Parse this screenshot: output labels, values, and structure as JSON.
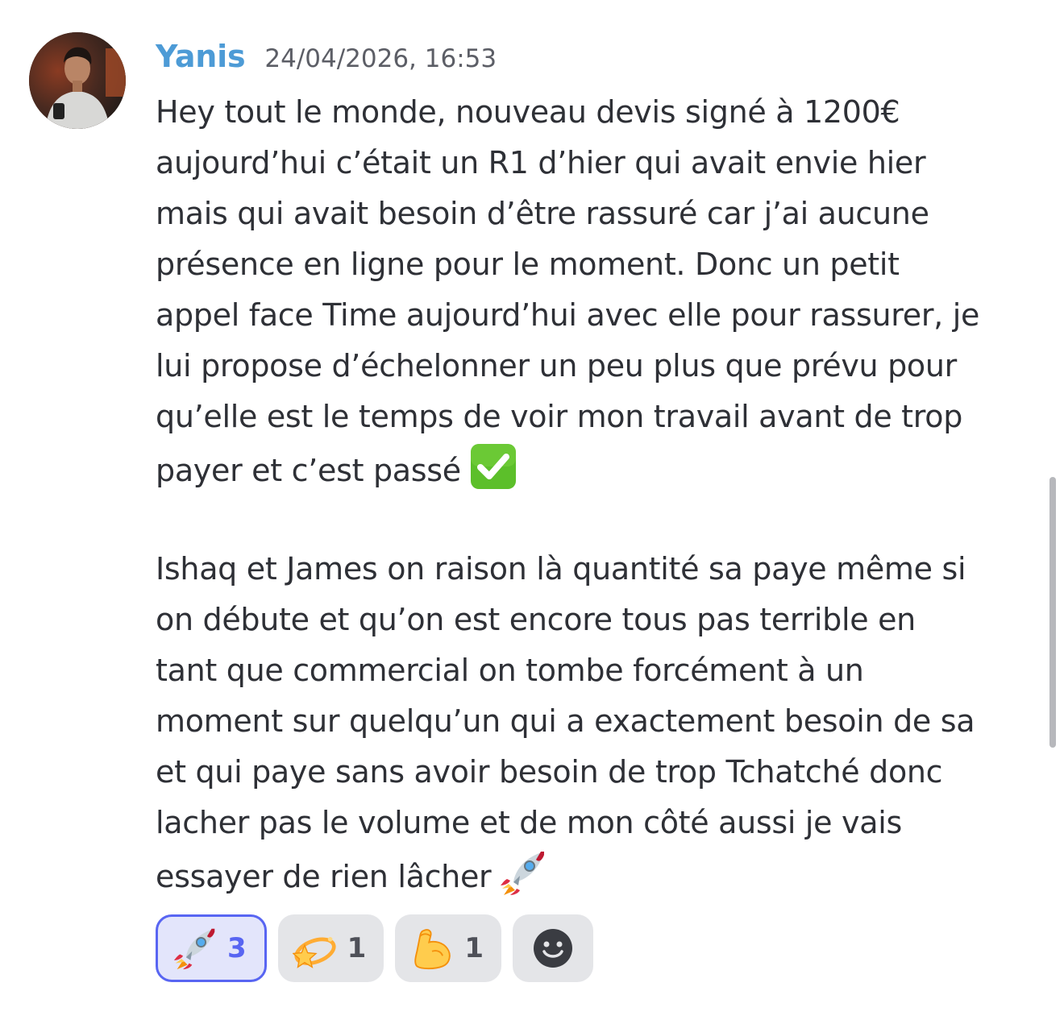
{
  "message": {
    "author": "Yanis",
    "timestamp": "24/04/2026, 16:53",
    "author_color": "#4d9bd6",
    "paragraph1": [
      "Hey tout le monde, nouveau devis signé à 1200€",
      "aujourd’hui c’était un R1 d’hier qui avait envie hier",
      "mais qui avait besoin d’être rassuré car j’ai aucune",
      "présence en ligne pour le moment. Donc un petit",
      "appel face Time aujourd’hui avec elle pour rassurer, je",
      "lui propose d’échelonner un peu plus que prévu pour",
      "qu’elle est le temps de voir mon travail avant de trop",
      "payer et c’est passé"
    ],
    "paragraph1_end_emoji": "white-check-mark",
    "paragraph2": [
      "Ishaq et James on raison là quantité sa paye même si",
      "on débute et qu’on est encore tous pas terrible en",
      "tant que commercial on tombe forcément à un",
      "moment sur quelqu’un qui a exactement besoin de sa",
      "et qui paye sans avoir besoin de trop Tchatché donc",
      "lacher pas le volume et de mon côté aussi je vais",
      "essayer de rien lâcher"
    ],
    "paragraph2_end_emoji": "rocket"
  },
  "reactions": [
    {
      "emoji": "rocket",
      "count": "3",
      "active": true
    },
    {
      "emoji": "dizzy",
      "count": "1",
      "active": false
    },
    {
      "emoji": "flexed-biceps",
      "count": "1",
      "active": false
    }
  ],
  "add_reaction_icon": "smiley-add-reaction-icon",
  "colors": {
    "active_reaction_border": "#5865f2",
    "active_reaction_bg": "#e3e5fb",
    "reaction_bg": "#e4e5e8"
  }
}
